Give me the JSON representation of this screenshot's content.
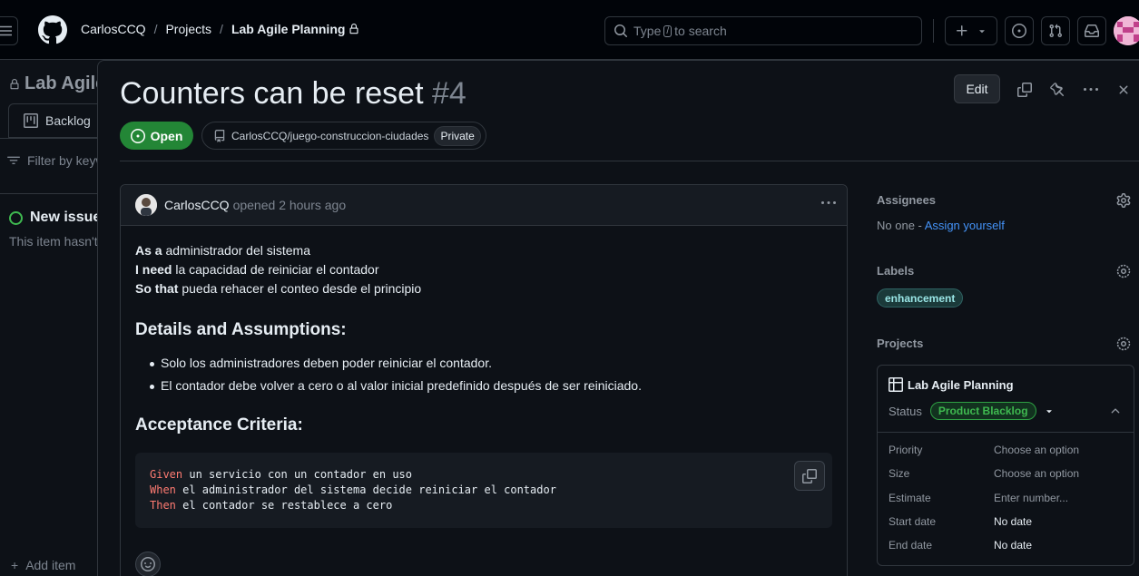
{
  "header": {
    "breadcrumb": [
      {
        "label": "CarlosCCQ"
      },
      {
        "label": "Projects"
      },
      {
        "label": "Lab Agile Planning"
      }
    ],
    "search": {
      "before": "Type",
      "key": "/",
      "after": "to search"
    }
  },
  "underlay": {
    "project_title": "Lab Agile Planning",
    "view_tab": "Backlog",
    "filter_placeholder": "Filter by keyword or by field",
    "issue_title": "New issue",
    "issue_subtitle": "This item hasn't been started",
    "add_item": "Add item"
  },
  "issue": {
    "title": "Counters can be reset",
    "number": "#4",
    "state": "Open",
    "repo": "CarlosCCQ/juego-construccion-ciudades",
    "visibility": "Private",
    "edit_label": "Edit",
    "comment": {
      "author": "CarlosCCQ",
      "action": "opened",
      "time": "2 hours ago",
      "story": [
        {
          "key": "As a",
          "text": "administrador del sistema"
        },
        {
          "key": "I need",
          "text": "la capacidad de reiniciar el contador"
        },
        {
          "key": "So that",
          "text": "pueda rehacer el conteo desde el principio"
        }
      ],
      "details_heading": "Details and Assumptions:",
      "details": [
        "Solo los administradores deben poder reiniciar el contador.",
        "El contador debe volver a cero o al valor inicial predefinido después de ser reiniciado."
      ],
      "acceptance_heading": "Acceptance Criteria:",
      "gherkin": [
        {
          "kw": "Given",
          "text": " un servicio con un contador en uso"
        },
        {
          "kw": "When",
          "text": " el administrador del sistema decide reiniciar el contador"
        },
        {
          "kw": "Then",
          "text": " el contador se restablece a cero"
        }
      ]
    }
  },
  "sidebar": {
    "assignees_heading": "Assignees",
    "assignees_none": "No one - ",
    "assign_yourself": "Assign yourself",
    "labels_heading": "Labels",
    "label": "enhancement",
    "projects_heading": "Projects",
    "project": {
      "name": "Lab Agile Planning",
      "status_label": "Status",
      "status_value": "Product Blacklog",
      "fields": [
        {
          "key": "Priority",
          "value": "Choose an option"
        },
        {
          "key": "Size",
          "value": "Choose an option"
        },
        {
          "key": "Estimate",
          "value": "Enter number..."
        },
        {
          "key": "Start date",
          "value": "No date"
        },
        {
          "key": "End date",
          "value": "No date"
        }
      ]
    }
  },
  "colors": {
    "open_green": "#238636",
    "link_blue": "#4493f8",
    "keyword_red": "#ff7b72"
  }
}
